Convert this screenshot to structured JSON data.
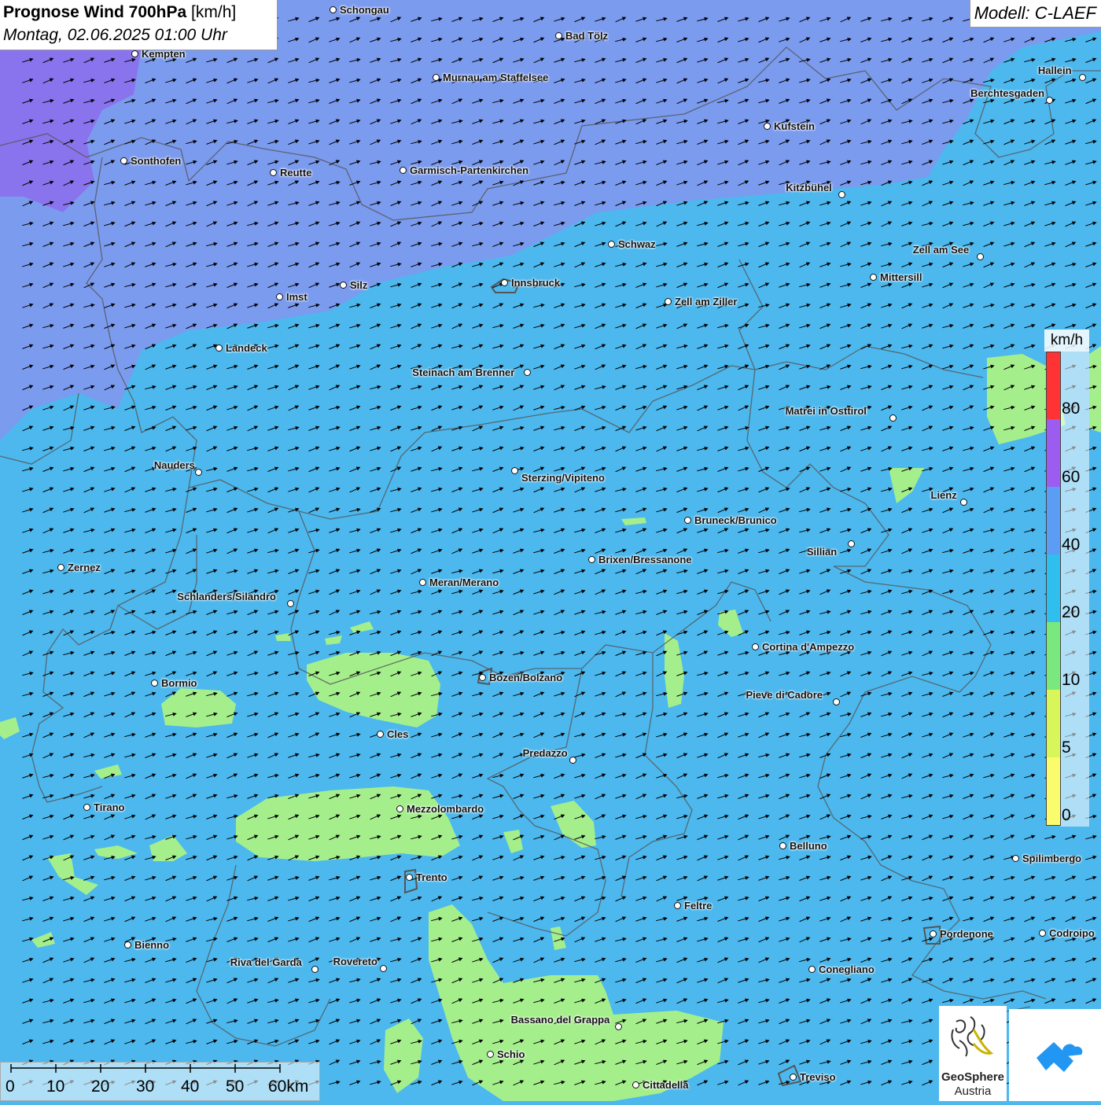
{
  "title": {
    "main": "Prognose Wind 700hPa",
    "unit": "[km/h]",
    "date": "Montag, 02.06.2025 01:00 Uhr"
  },
  "model": "Modell: C-LAEF",
  "legend": {
    "unit": "km/h",
    "labels": [
      "80",
      "60",
      "40",
      "20",
      "10",
      "5",
      "0"
    ],
    "colors": [
      "#ff3333",
      "#9c5cf0",
      "#5b9cf5",
      "#2fbfee",
      "#79e87d",
      "#d8f55a",
      "#fbfb6e"
    ]
  },
  "scale": {
    "labels": [
      "0",
      "10",
      "20",
      "30",
      "40",
      "50",
      "60km"
    ]
  },
  "logo": {
    "name": "GeoSphere",
    "sub": "Austria"
  },
  "colors": {
    "purple": "#8a74ee",
    "blue": "#7b9bef",
    "cyan": "#4cb8ee",
    "green": "#a4ef8c",
    "border": "#555555"
  },
  "wind": {
    "direction": "WSW-to-ENE",
    "arrow_color": "#000000"
  },
  "cities": [
    {
      "name": "Schongau"
    },
    {
      "name": "Bad Tölz"
    },
    {
      "name": "Kempten"
    },
    {
      "name": "Murnau am Staffelsee"
    },
    {
      "name": "Hallein"
    },
    {
      "name": "Berchtesgaden"
    },
    {
      "name": "Kufstein"
    },
    {
      "name": "Sonthofen"
    },
    {
      "name": "Reutte"
    },
    {
      "name": "Garmisch-Partenkirchen"
    },
    {
      "name": "Kitzbühel"
    },
    {
      "name": "Schwaz"
    },
    {
      "name": "Zell am See"
    },
    {
      "name": "Mittersill"
    },
    {
      "name": "Innsbruck"
    },
    {
      "name": "Imst"
    },
    {
      "name": "Silz"
    },
    {
      "name": "Zell am Ziller"
    },
    {
      "name": "Landeck"
    },
    {
      "name": "Steinach am Brenner"
    },
    {
      "name": "Matrei in Osttirol"
    },
    {
      "name": "Nauders"
    },
    {
      "name": "Sterzing/Vipiteno"
    },
    {
      "name": "Lienz"
    },
    {
      "name": "Bruneck/Brunico"
    },
    {
      "name": "Sillian"
    },
    {
      "name": "Zernez"
    },
    {
      "name": "Brixen/Bressanone"
    },
    {
      "name": "Meran/Merano"
    },
    {
      "name": "Schlanders/Silandro"
    },
    {
      "name": "Cortina d'Ampezzo"
    },
    {
      "name": "Bormio"
    },
    {
      "name": "Bozen/Bolzano"
    },
    {
      "name": "Pieve di Cadore"
    },
    {
      "name": "Cles"
    },
    {
      "name": "Predazzo"
    },
    {
      "name": "Tirano"
    },
    {
      "name": "Mezzolombardo"
    },
    {
      "name": "Belluno"
    },
    {
      "name": "Spilimbergo"
    },
    {
      "name": "Trento"
    },
    {
      "name": "Feltre"
    },
    {
      "name": "Bienno"
    },
    {
      "name": "Pordenone"
    },
    {
      "name": "Codroipo"
    },
    {
      "name": "Riva del Garda"
    },
    {
      "name": "Rovereto"
    },
    {
      "name": "Conegliano"
    },
    {
      "name": "Bassano del Grappa"
    },
    {
      "name": "Schio"
    },
    {
      "name": "Treviso"
    },
    {
      "name": "Cittadella"
    }
  ]
}
